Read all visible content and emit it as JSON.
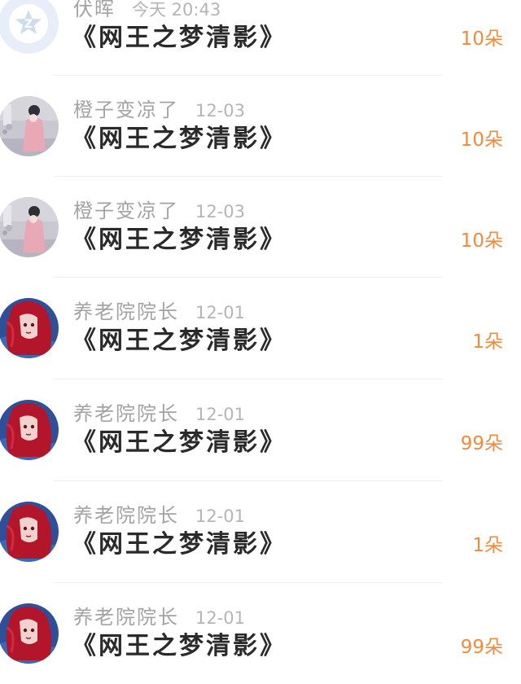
{
  "records": [
    {
      "name": "伏晖",
      "time": "今天 20:43",
      "title": "《网王之梦清影》",
      "amount": "10朵",
      "avatar": "default-star-avatar"
    },
    {
      "name": "橙子变凉了",
      "time": "12-03",
      "title": "《网王之梦清影》",
      "amount": "10朵",
      "avatar": "girl-portrait-avatar"
    },
    {
      "name": "橙子变凉了",
      "time": "12-03",
      "title": "《网王之梦清影》",
      "amount": "10朵",
      "avatar": "girl-portrait-avatar"
    },
    {
      "name": "养老院院长",
      "time": "12-01",
      "title": "《网王之梦清影》",
      "amount": "1朵",
      "avatar": "red-hair-girl-avatar"
    },
    {
      "name": "养老院院长",
      "time": "12-01",
      "title": "《网王之梦清影》",
      "amount": "99朵",
      "avatar": "red-hair-girl-avatar"
    },
    {
      "name": "养老院院长",
      "time": "12-01",
      "title": "《网王之梦清影》",
      "amount": "1朵",
      "avatar": "red-hair-girl-avatar"
    },
    {
      "name": "养老院院长",
      "time": "12-01",
      "title": "《网王之梦清影》",
      "amount": "99朵",
      "avatar": "red-hair-girl-avatar"
    }
  ],
  "colors": {
    "amount": "#f08a3c",
    "title": "#2a2a2a",
    "meta": "#a3a3a3",
    "divider": "#eeeeee"
  }
}
